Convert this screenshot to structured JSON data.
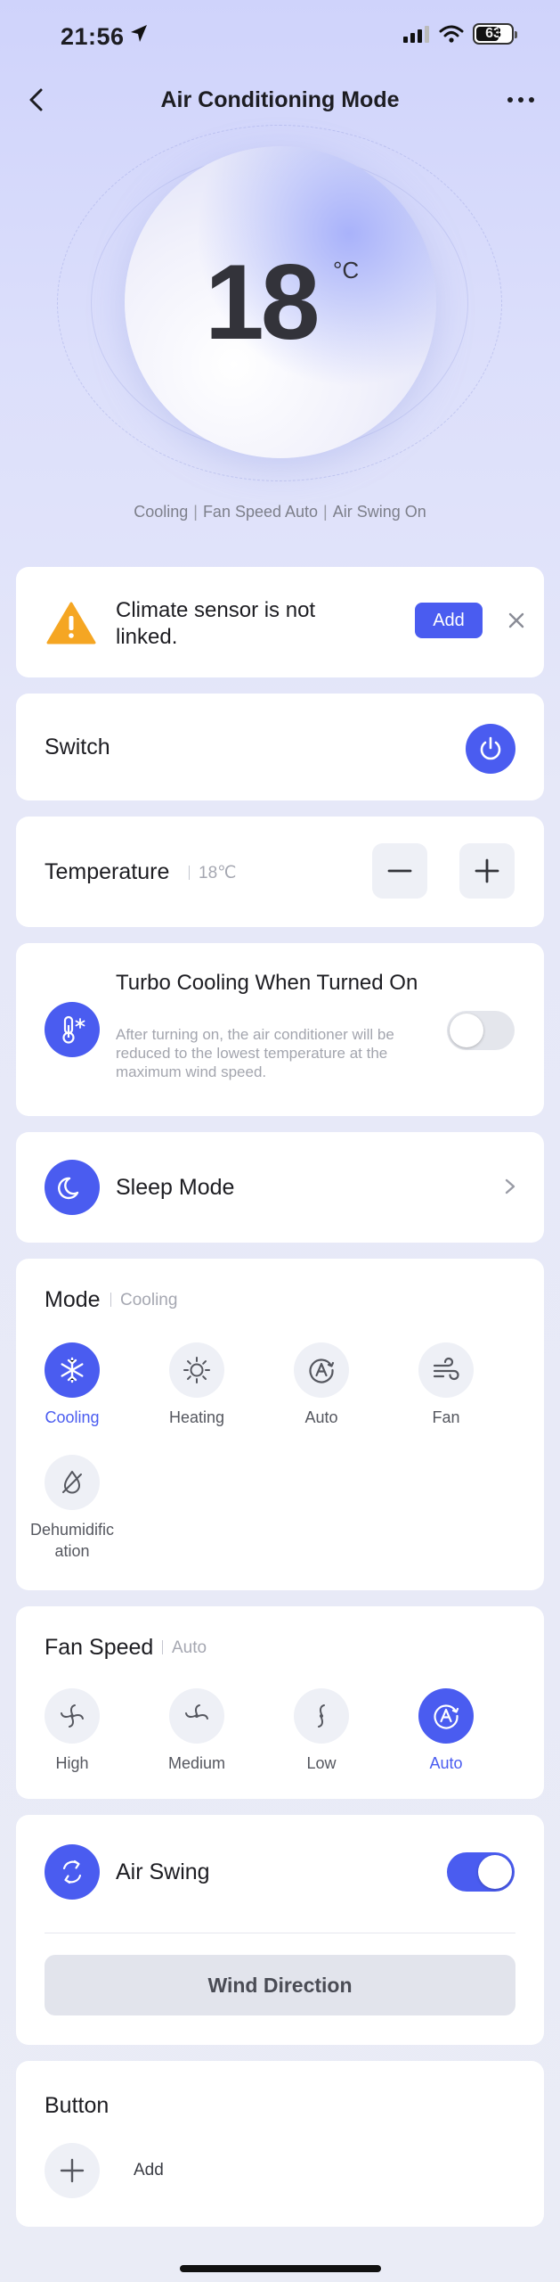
{
  "status_bar": {
    "time": "21:56",
    "battery": "63"
  },
  "nav": {
    "title": "Air Conditioning Mode"
  },
  "hero": {
    "temperature": "18",
    "unit": "°C",
    "status_parts": [
      "Cooling",
      "Fan Speed Auto",
      "Air Swing On"
    ],
    "separator": "|"
  },
  "alert": {
    "message": "Climate sensor is not linked.",
    "add_label": "Add"
  },
  "switch": {
    "label": "Switch"
  },
  "temperature": {
    "label": "Temperature",
    "value": "18℃"
  },
  "turbo": {
    "title": "Turbo Cooling When Turned On",
    "description": "After turning on, the air conditioner will be reduced to the lowest temperature at the maximum wind speed.",
    "enabled": false
  },
  "sleep": {
    "label": "Sleep Mode"
  },
  "mode": {
    "title": "Mode",
    "current": "Cooling",
    "options": [
      {
        "label": "Cooling",
        "icon": "snowflake-icon",
        "active": true
      },
      {
        "label": "Heating",
        "icon": "sun-icon",
        "active": false
      },
      {
        "label": "Auto",
        "icon": "auto-mode-icon",
        "active": false
      },
      {
        "label": "Fan",
        "icon": "wind-icon",
        "active": false
      },
      {
        "label": "Dehumidific ation",
        "icon": "droplet-off-icon",
        "active": false
      }
    ]
  },
  "fan_speed": {
    "title": "Fan Speed",
    "current": "Auto",
    "options": [
      {
        "label": "High",
        "icon": "fan-high-icon",
        "active": false
      },
      {
        "label": "Medium",
        "icon": "fan-medium-icon",
        "active": false
      },
      {
        "label": "Low",
        "icon": "fan-low-icon",
        "active": false
      },
      {
        "label": "Auto",
        "icon": "fan-auto-icon",
        "active": true
      }
    ]
  },
  "air_swing": {
    "label": "Air Swing",
    "enabled": true,
    "wind_direction_label": "Wind Direction"
  },
  "buttons": {
    "title": "Button",
    "add_label": "Add"
  },
  "colors": {
    "accent": "#4a5cf0",
    "card": "#ffffff",
    "muted_text": "#a5a7b1",
    "warning": "#f5a623"
  }
}
